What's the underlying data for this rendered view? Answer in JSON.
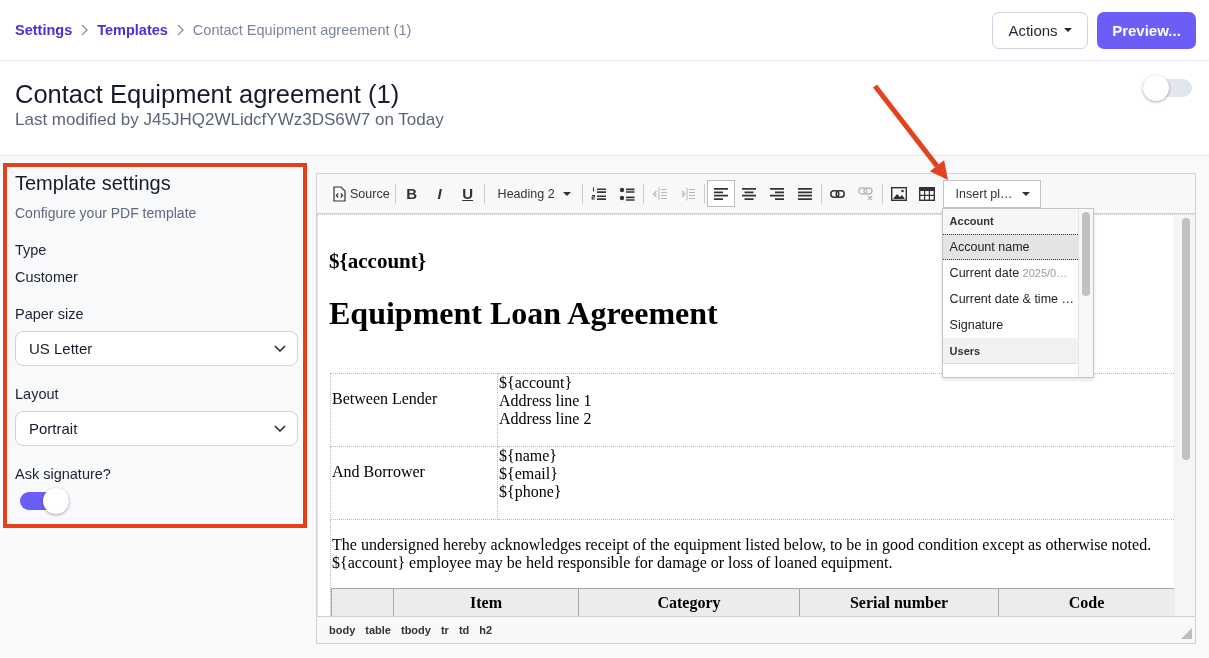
{
  "breadcrumb": [
    {
      "label": "Settings",
      "current": false
    },
    {
      "label": "Templates",
      "current": false
    },
    {
      "label": "Contact Equipment agreement (1)",
      "current": true
    }
  ],
  "header_buttons": [
    {
      "kind": "menu",
      "label": "Actions"
    },
    {
      "kind": "primary",
      "label": "Preview..."
    }
  ],
  "page": {
    "title": "Contact Equipment agreement (1)",
    "subtitle": "Last modified by J45JHQ2WLidcfYWz3DS6W7 on Today",
    "switch_on": false
  },
  "template_settings": {
    "highlighted": true,
    "title": "Template settings",
    "description": "Configure your PDF template",
    "fields": [
      {
        "kind": "text",
        "label": "Type",
        "value": "Customer"
      },
      {
        "kind": "select",
        "label": "Paper size",
        "value": "US Letter"
      },
      {
        "kind": "select",
        "label": "Layout",
        "value": "Portrait"
      },
      {
        "kind": "toggle",
        "label": "Ask signature?",
        "on": true
      }
    ]
  },
  "editor": {
    "toolbar": [
      [
        {
          "kind": "source",
          "label": "Source",
          "disabled": false,
          "pressed": false
        }
      ],
      [
        {
          "kind": "bold",
          "label": "B",
          "disabled": false,
          "pressed": false
        },
        {
          "kind": "italic",
          "label": "I",
          "disabled": false,
          "pressed": false
        },
        {
          "kind": "underline",
          "label": "U",
          "disabled": false,
          "pressed": false
        }
      ],
      [
        {
          "kind": "format",
          "value": "Heading 2",
          "expanded": false,
          "disabled": false,
          "pressed": false
        }
      ],
      [
        {
          "kind": "numbered-list",
          "disabled": false,
          "pressed": false
        },
        {
          "kind": "bulleted-list",
          "disabled": false,
          "pressed": false
        }
      ],
      [
        {
          "kind": "outdent",
          "disabled": true,
          "pressed": false
        },
        {
          "kind": "indent",
          "disabled": true,
          "pressed": false
        }
      ],
      [
        {
          "kind": "align-left",
          "disabled": false,
          "pressed": true
        },
        {
          "kind": "align-center",
          "disabled": false,
          "pressed": false
        },
        {
          "kind": "align-right",
          "disabled": false,
          "pressed": false
        },
        {
          "kind": "justify",
          "disabled": false,
          "pressed": false
        }
      ],
      [
        {
          "kind": "link",
          "disabled": false,
          "pressed": false
        },
        {
          "kind": "unlink",
          "disabled": true,
          "pressed": false
        }
      ],
      [
        {
          "kind": "image",
          "disabled": false,
          "pressed": false
        },
        {
          "kind": "table",
          "disabled": false,
          "pressed": false
        },
        {
          "kind": "insert",
          "value": "Insert pl…",
          "expanded": true,
          "disabled": false,
          "pressed": false
        }
      ]
    ],
    "insert_menu": {
      "groups": [
        {
          "title": "Account",
          "items": [
            {
              "label": "Account name",
              "selected": true
            },
            {
              "label": "Current date",
              "hint": "2025/0…",
              "selected": false
            },
            {
              "label": "Current date & time …",
              "selected": false
            },
            {
              "label": "Signature",
              "selected": false
            }
          ]
        },
        {
          "title": "Users"
        }
      ]
    },
    "document": {
      "heading": "${account}",
      "title": "Equipment Loan Agreement",
      "parties": [
        {
          "role": "Between Lender",
          "lines": [
            "${account}",
            "Address line 1",
            "Address line 2"
          ]
        },
        {
          "role": "And Borrower",
          "lines": [
            "${name}",
            "${email}",
            "${phone}"
          ]
        }
      ],
      "notice": "The undersigned hereby acknowledges receipt of the equipment listed below, to be in good condition except as otherwise noted. ${account} employee may be held responsible for damage or loss of loaned equipment.",
      "items_columns": [
        "Item",
        "Category",
        "Serial number",
        "Code"
      ]
    },
    "element_path": [
      "body",
      "table",
      "tbody",
      "tr",
      "td",
      "h2"
    ]
  }
}
